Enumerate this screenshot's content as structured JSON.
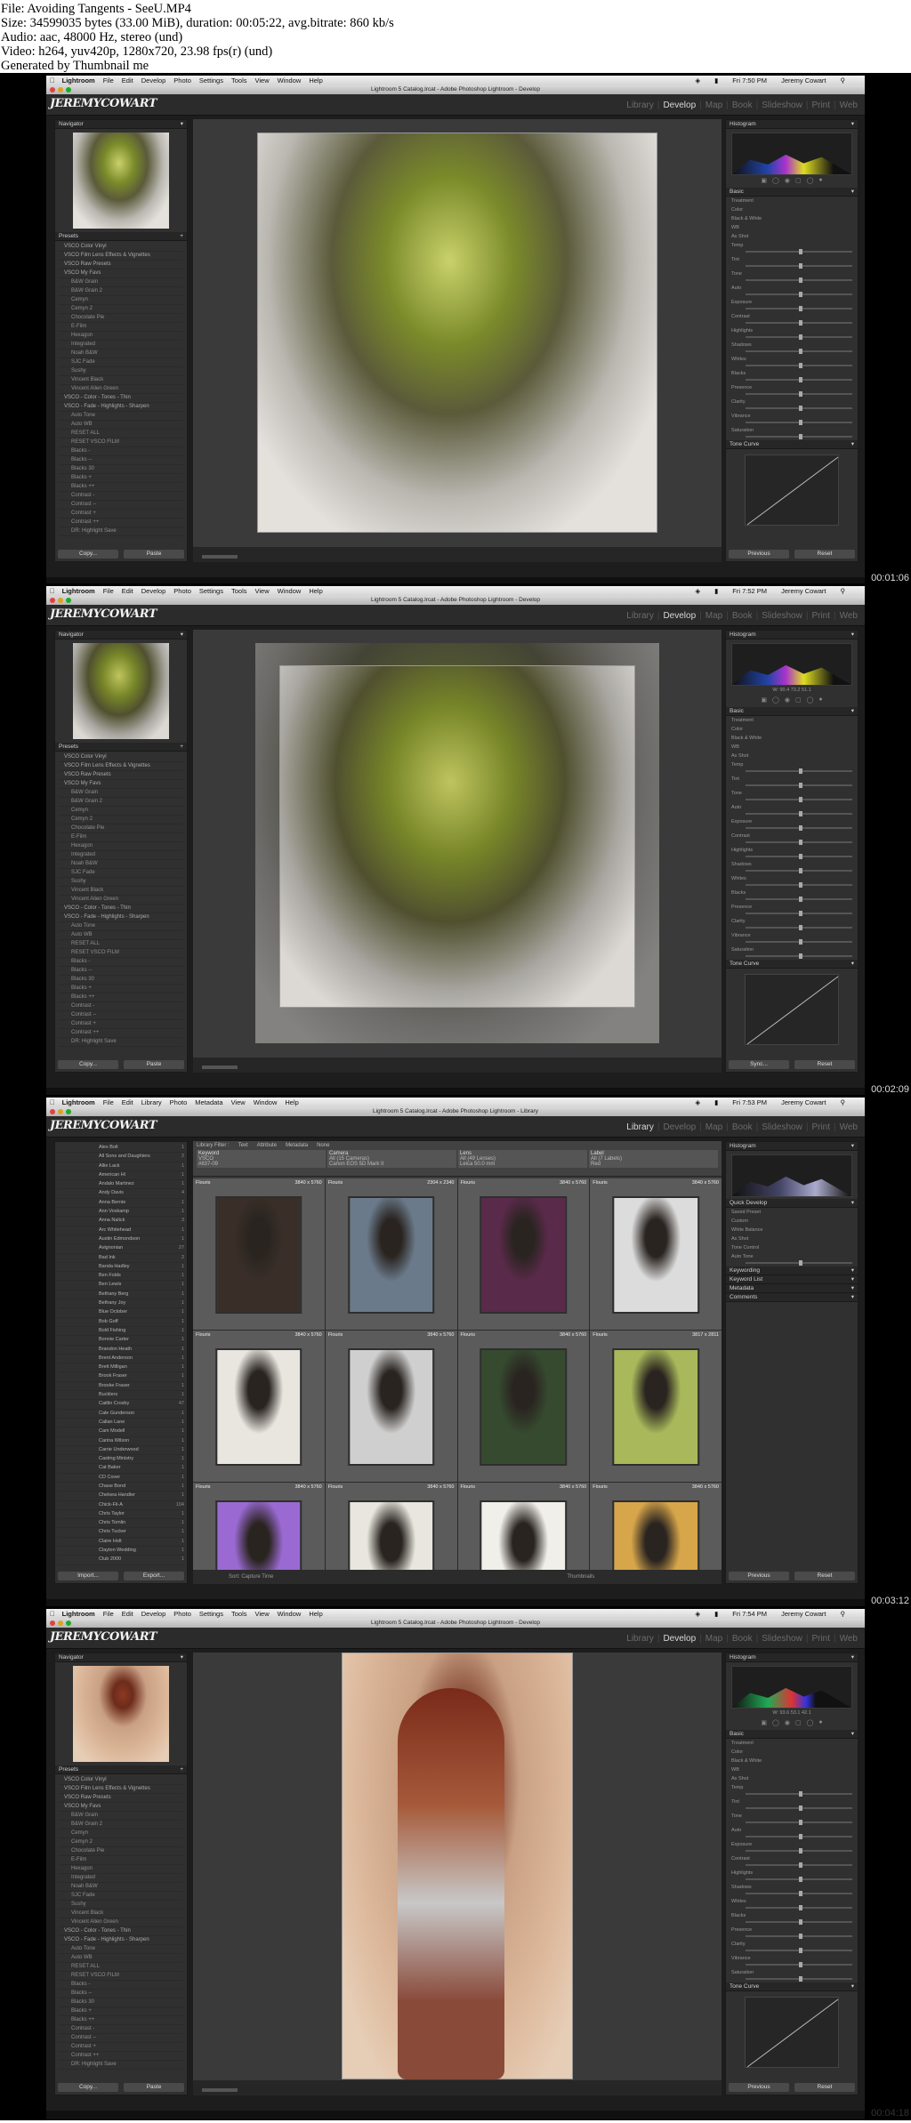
{
  "header": {
    "lines": [
      "File: Avoiding Tangents - SeeU.MP4",
      "Size: 34599035 bytes (33.00 MiB), duration: 00:05:22, avg.bitrate: 860 kb/s",
      "Audio: aac, 48000 Hz, stereo (und)",
      "Video: h264, yuv420p, 1280x720, 23.98 fps(r) (und)",
      "Generated by Thumbnail me"
    ]
  },
  "menu": {
    "apple": "",
    "app": "Lightroom",
    "items_develop": [
      "File",
      "Edit",
      "Develop",
      "Photo",
      "Settings",
      "Tools",
      "View",
      "Window",
      "Help"
    ],
    "items_library": [
      "File",
      "Edit",
      "Library",
      "Photo",
      "Metadata",
      "View",
      "Window",
      "Help"
    ],
    "user": "Jeremy Cowart"
  },
  "brand": {
    "logo": "JEREMYCOWART"
  },
  "modules": [
    "Library",
    "Develop",
    "Map",
    "Book",
    "Slideshow",
    "Print",
    "Web"
  ],
  "panels": {
    "navigator": "Navigator",
    "presets": "Presets",
    "histogram": "Histogram",
    "basic": "Basic",
    "tone_curve": "Tone Curve",
    "copy": "Copy...",
    "paste": "Paste",
    "previous": "Previous",
    "reset": "Reset",
    "sync": "Sync...",
    "import": "Import...",
    "export": "Export...",
    "quick_develop": "Quick Develop",
    "keywording": "Keywording",
    "keyword_list": "Keyword List",
    "metadata": "Metadata",
    "comments": "Comments"
  },
  "presets": [
    "VSCO Color Vinyl",
    "VSCO Film Lens Effects & Vignettes",
    "VSCO Raw Presets",
    "VSCO My Favs",
    "B&W Grain",
    "B&W Grain 2",
    "Cemyn",
    "Cemyn 2",
    "Chocolate Pie",
    "E-Film",
    "Hexagon",
    "Integrated",
    "Noah B&W",
    "SJC Fade",
    "Sushy",
    "Vincent Black",
    "Vincent Alien Green",
    "VSCO - Color - Tones - Thin",
    "VSCO - Fade - Highlights - Sharpen",
    "Auto Tone",
    "Auto WB",
    "RESET ALL",
    "RESET VSCO FILM",
    "Blacks -",
    "Blacks --",
    "Blacks 30",
    "Blacks +",
    "Blacks ++",
    "Contrast -",
    "Contrast --",
    "Contrast +",
    "Contrast ++",
    "DR: Highlight Save"
  ],
  "folders": [
    {
      "name": "Alex Bolt",
      "count": "1"
    },
    {
      "name": "All Sons and Daughters",
      "count": "2"
    },
    {
      "name": "Allie Lack",
      "count": "1"
    },
    {
      "name": "American Hi",
      "count": "1"
    },
    {
      "name": "Andalo Martinez",
      "count": "1"
    },
    {
      "name": "Andy Davis",
      "count": "4"
    },
    {
      "name": "Anna Bernie",
      "count": "1"
    },
    {
      "name": "Ann Voskamp",
      "count": "1"
    },
    {
      "name": "Anna Nalick",
      "count": "3"
    },
    {
      "name": "Arc Whitehead",
      "count": "1"
    },
    {
      "name": "Austin Edmondson",
      "count": "1"
    },
    {
      "name": "Avignonian",
      "count": "27"
    },
    {
      "name": "Bad Ink",
      "count": "2"
    },
    {
      "name": "Banda Hadley",
      "count": "1"
    },
    {
      "name": "Ben Folds",
      "count": "1"
    },
    {
      "name": "Ben Lewis",
      "count": "1"
    },
    {
      "name": "Bethany Berg",
      "count": "1"
    },
    {
      "name": "Bethany Joy",
      "count": "1"
    },
    {
      "name": "Blue October",
      "count": "1"
    },
    {
      "name": "Bob Goff",
      "count": "1"
    },
    {
      "name": "Bold Fishing",
      "count": "1"
    },
    {
      "name": "Bonnie Carter",
      "count": "1"
    },
    {
      "name": "Brandon Heath",
      "count": "1"
    },
    {
      "name": "Brent Anderson",
      "count": "1"
    },
    {
      "name": "Brett Milligan",
      "count": "1"
    },
    {
      "name": "Brook Fraser",
      "count": "1"
    },
    {
      "name": "Brooke Fraser",
      "count": "1"
    },
    {
      "name": "Bucklers",
      "count": "1"
    },
    {
      "name": "Caitlin Crosby",
      "count": "47"
    },
    {
      "name": "Cale Gunderson",
      "count": "1"
    },
    {
      "name": "Callan Lane",
      "count": "1"
    },
    {
      "name": "Cam Modell",
      "count": "1"
    },
    {
      "name": "Carina Wilson",
      "count": "1"
    },
    {
      "name": "Carrie Underwood",
      "count": "1"
    },
    {
      "name": "Casting Ministry",
      "count": "1"
    },
    {
      "name": "Cat Baker",
      "count": "1"
    },
    {
      "name": "CD Cover",
      "count": "1"
    },
    {
      "name": "Chase Bond",
      "count": "1"
    },
    {
      "name": "Chelsea Handler",
      "count": "1"
    },
    {
      "name": "Chick-Fil-A",
      "count": "104"
    },
    {
      "name": "Chris Taylor",
      "count": "1"
    },
    {
      "name": "Chris Tomlin",
      "count": "1"
    },
    {
      "name": "Chris Tucker",
      "count": "1"
    },
    {
      "name": "Claire Holt",
      "count": "1"
    },
    {
      "name": "Clayton Wedding",
      "count": "1"
    },
    {
      "name": "Club 2000",
      "count": "1"
    }
  ],
  "library_grid": {
    "filter_label": "Library Filter :",
    "tabs": [
      "Text",
      "Attribute",
      "Metadata",
      "None"
    ],
    "columns": [
      {
        "label": "Keyword",
        "rows": [
          "VSCO",
          "#837-09"
        ]
      },
      {
        "label": "Camera",
        "rows": [
          "All (15 Cameras)",
          "Canon EOS 5D Mark II"
        ]
      },
      {
        "label": "Lens",
        "rows": [
          "All (49 Lenses)",
          "Leica 50.0 mm"
        ]
      },
      {
        "label": "Label",
        "rows": [
          "All (7 Labels)",
          "Red"
        ]
      }
    ],
    "cells": [
      {
        "label": "Flouris",
        "size": "3840 x 5760"
      },
      {
        "label": "Flouris",
        "size": "2304 x 2340"
      },
      {
        "label": "Flouris",
        "size": "3840 x 5760"
      },
      {
        "label": "Flouris",
        "size": "3840 x 5760"
      },
      {
        "label": "Flouris",
        "size": "3840 x 5760"
      },
      {
        "label": "Flouris",
        "size": "3840 x 5760"
      },
      {
        "label": "Flouris",
        "size": "3840 x 5760"
      },
      {
        "label": "Flouris",
        "size": "3817 x 2811"
      },
      {
        "label": "Flouris",
        "size": "3840 x 5760"
      },
      {
        "label": "Flouris",
        "size": "3840 x 5760"
      },
      {
        "label": "Flouris",
        "size": "3840 x 5760"
      },
      {
        "label": "Flouris",
        "size": "3840 x 5760"
      }
    ],
    "sort_label": "Sort: Capture Time",
    "thumbnails_label": "Thumbnails"
  },
  "frames": [
    {
      "timestamp": "",
      "clock": "Fri 7:50 PM",
      "window_title": "Lightroom 5 Catalog.lrcat - Adobe Photoshop Lightroom - Develop",
      "mode": "develop",
      "histo_read": "",
      "rows": [
        "Treatment",
        "Color",
        "Black & White",
        "WB",
        "As Shot",
        "Temp",
        "Tint",
        "Tone",
        "Auto",
        "Exposure",
        "Contrast",
        "Highlights",
        "Shadows",
        "Whites",
        "Blacks",
        "Presence",
        "Clarity",
        "Vibrance",
        "Saturation"
      ]
    },
    {
      "timestamp": "00:01:06",
      "clock": "Fri 7:52 PM",
      "window_title": "Lightroom 5 Catalog.lrcat - Adobe Photoshop Lightroom - Develop",
      "mode": "develop",
      "histo_read": "W: 90.4   73.2   51.1",
      "rows": [
        "Treatment",
        "Color",
        "Black & White",
        "WB",
        "As Shot",
        "Temp",
        "Tint",
        "Tone",
        "Auto",
        "Exposure",
        "Contrast",
        "Highlights",
        "Shadows",
        "Whites",
        "Blacks",
        "Presence",
        "Clarity",
        "Vibrance",
        "Saturation"
      ]
    },
    {
      "timestamp": "00:02:09",
      "clock": "Fri 7:53 PM",
      "window_title": "Lightroom 5 Catalog.lrcat - Adobe Photoshop Lightroom - Library",
      "mode": "library",
      "histo_read": "",
      "rows": [
        "Saved Preset",
        "Custom",
        "White Balance",
        "As Shot",
        "Tone Control",
        "Auto Tone"
      ]
    },
    {
      "timestamp": "00:03:12",
      "clock": "Fri 7:54 PM",
      "window_title": "Lightroom 5 Catalog.lrcat - Adobe Photoshop Lightroom - Develop",
      "mode": "develop",
      "histo_read": "W: 93.6   53.1   42.1",
      "rows": [
        "Treatment",
        "Color",
        "Black & White",
        "WB",
        "As Shot",
        "Temp",
        "Tint",
        "Tone",
        "Auto",
        "Exposure",
        "Contrast",
        "Highlights",
        "Shadows",
        "Whites",
        "Blacks",
        "Presence",
        "Clarity",
        "Vibrance",
        "Saturation"
      ]
    }
  ],
  "last_timestamp": "00:04:18",
  "colors": {
    "frame_bg": "#000000",
    "panel_bg": "#303030",
    "header_bg": "#ffffff",
    "photo_green": "#7a8a2a",
    "photo_warm": "#c9a083"
  }
}
